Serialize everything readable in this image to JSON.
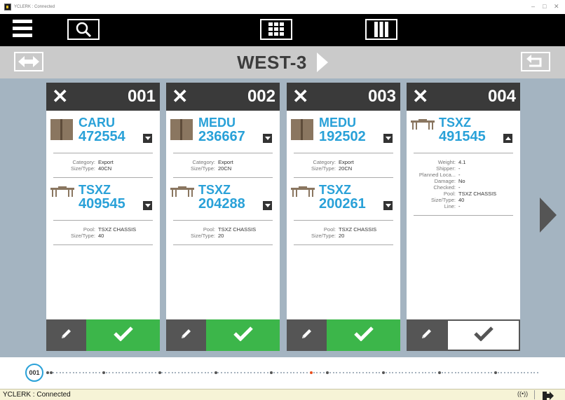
{
  "window": {
    "title": "YCLERK : Connected",
    "controls": [
      "–",
      "□",
      "✕"
    ]
  },
  "toolbar": {
    "menu_icon": "hamburger-menu-icon",
    "search_icon": "search-icon",
    "grid_icon": "grid-view-icon",
    "columns_icon": "column-view-icon"
  },
  "location": {
    "title": "WEST-3",
    "left_icon": "swap-arrows-icon",
    "right_icon": "return-icon",
    "next_icon": "chevron-right-icon"
  },
  "cards": [
    {
      "number": "001",
      "units": [
        {
          "kind": "container",
          "code": "CARU",
          "num": "472554",
          "expanded": false,
          "details": [
            [
              "Category:",
              "Export"
            ],
            [
              "Size/Type:",
              "40CN"
            ]
          ]
        },
        {
          "kind": "chassis",
          "code": "TSXZ",
          "num": "409545",
          "expanded": false,
          "details": [
            [
              "Pool:",
              "TSXZ CHASSIS"
            ],
            [
              "Size/Type:",
              "40"
            ]
          ]
        }
      ],
      "confirm_style": "green"
    },
    {
      "number": "002",
      "units": [
        {
          "kind": "container",
          "code": "MEDU",
          "num": "236667",
          "expanded": false,
          "details": [
            [
              "Category:",
              "Export"
            ],
            [
              "Size/Type:",
              "20CN"
            ]
          ]
        },
        {
          "kind": "chassis",
          "code": "TSXZ",
          "num": "204288",
          "expanded": false,
          "details": [
            [
              "Pool:",
              "TSXZ CHASSIS"
            ],
            [
              "Size/Type:",
              "20"
            ]
          ]
        }
      ],
      "confirm_style": "green"
    },
    {
      "number": "003",
      "units": [
        {
          "kind": "container",
          "code": "MEDU",
          "num": "192502",
          "expanded": false,
          "details": [
            [
              "Category:",
              "Export"
            ],
            [
              "Size/Type:",
              "20CN"
            ]
          ]
        },
        {
          "kind": "chassis",
          "code": "TSXZ",
          "num": "200261",
          "expanded": false,
          "details": [
            [
              "Pool:",
              "TSXZ CHASSIS"
            ],
            [
              "Size/Type:",
              "20"
            ]
          ]
        }
      ],
      "confirm_style": "green"
    },
    {
      "number": "004",
      "units": [
        {
          "kind": "chassis",
          "code": "TSXZ",
          "num": "491545",
          "expanded": true,
          "details": [
            [
              "Weight:",
              "4.1"
            ],
            [
              "Shipper:",
              "-"
            ],
            [
              "Planned Loca...",
              "-"
            ],
            [
              "Damage:",
              "No"
            ],
            [
              "Checked:",
              "-"
            ],
            [
              "Pool:",
              "TSXZ CHASSIS"
            ],
            [
              "Size/Type:",
              "40"
            ],
            [
              "Line:",
              "-"
            ]
          ]
        }
      ],
      "confirm_style": "white"
    }
  ],
  "progress": {
    "current": "001",
    "total_stops": 150,
    "current_index": 0,
    "highlight_index": 80
  },
  "status": {
    "text": "YCLERK : Connected",
    "signal_icon": "((•))",
    "exit_icon": "exit-icon"
  },
  "colors": {
    "accent_blue": "#29a1d8",
    "confirm_green": "#3cb64a",
    "header_dark": "#3a3a3a",
    "content_bg": "#a4b4c1"
  }
}
